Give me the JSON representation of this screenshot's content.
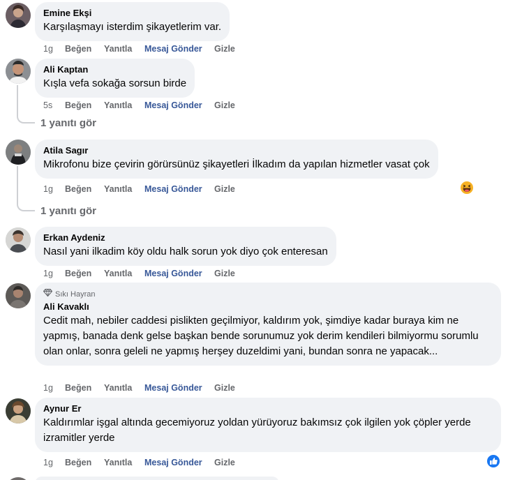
{
  "actions": {
    "like": "Beğen",
    "reply": "Yanıtla",
    "message": "Mesaj Gönder",
    "hide": "Gizle"
  },
  "comments": [
    {
      "author": "Emine Ekşi",
      "text": "Karşılaşmayı isterdim şikayetlerim var.",
      "time": "1g"
    },
    {
      "author": "Ali Kaptan",
      "text": "Kışla vefa sokağa sorsun birde",
      "time": "5s",
      "replies": "1 yanıtı gör"
    },
    {
      "author": "Atila Sagır",
      "text": "Mikrofonu bize çevirin görürsünüz şikayetleri İlkadım da yapılan hizmetler vasat çok",
      "time": "1g",
      "replies": "1 yanıtı gör",
      "reaction_icon": "haha-reaction-icon"
    },
    {
      "author": "Erkan Aydeniz",
      "text": "Nasıl yani ilkadim köy oldu halk sorun yok diyo çok enteresan",
      "time": "1g"
    },
    {
      "badge": "Sıkı Hayran",
      "badge_icon": "diamond-icon",
      "author": "Ali Kavaklı",
      "text": "Cedit mah, nebiler caddesi pislikten geçilmiyor, kaldırım yok, şimdiye kadar buraya kim ne yapmış, banada denk gelse başkan bende sorunumuz yok derim kendileri bilmiyormu sorumlu olan onlar, sonra geleli ne yapmış herşey duzeldimi yani, bundan sonra ne yapacak...",
      "time": "1g"
    },
    {
      "author": "Aynur Er",
      "text": "Kaldırımlar işgal altında gecemiyoruz yoldan yürüyoruz bakımsız çok ilgilen yok çöpler yerde izramitler yerde",
      "time": "1g",
      "reaction_icon": "like-reaction-icon"
    }
  ],
  "colors": {
    "bubble": "#f0f2f5",
    "meta_text": "#65676b",
    "message_link": "#385898",
    "like_blue": "#1877f2",
    "haha_yellow": "#f7b125"
  }
}
